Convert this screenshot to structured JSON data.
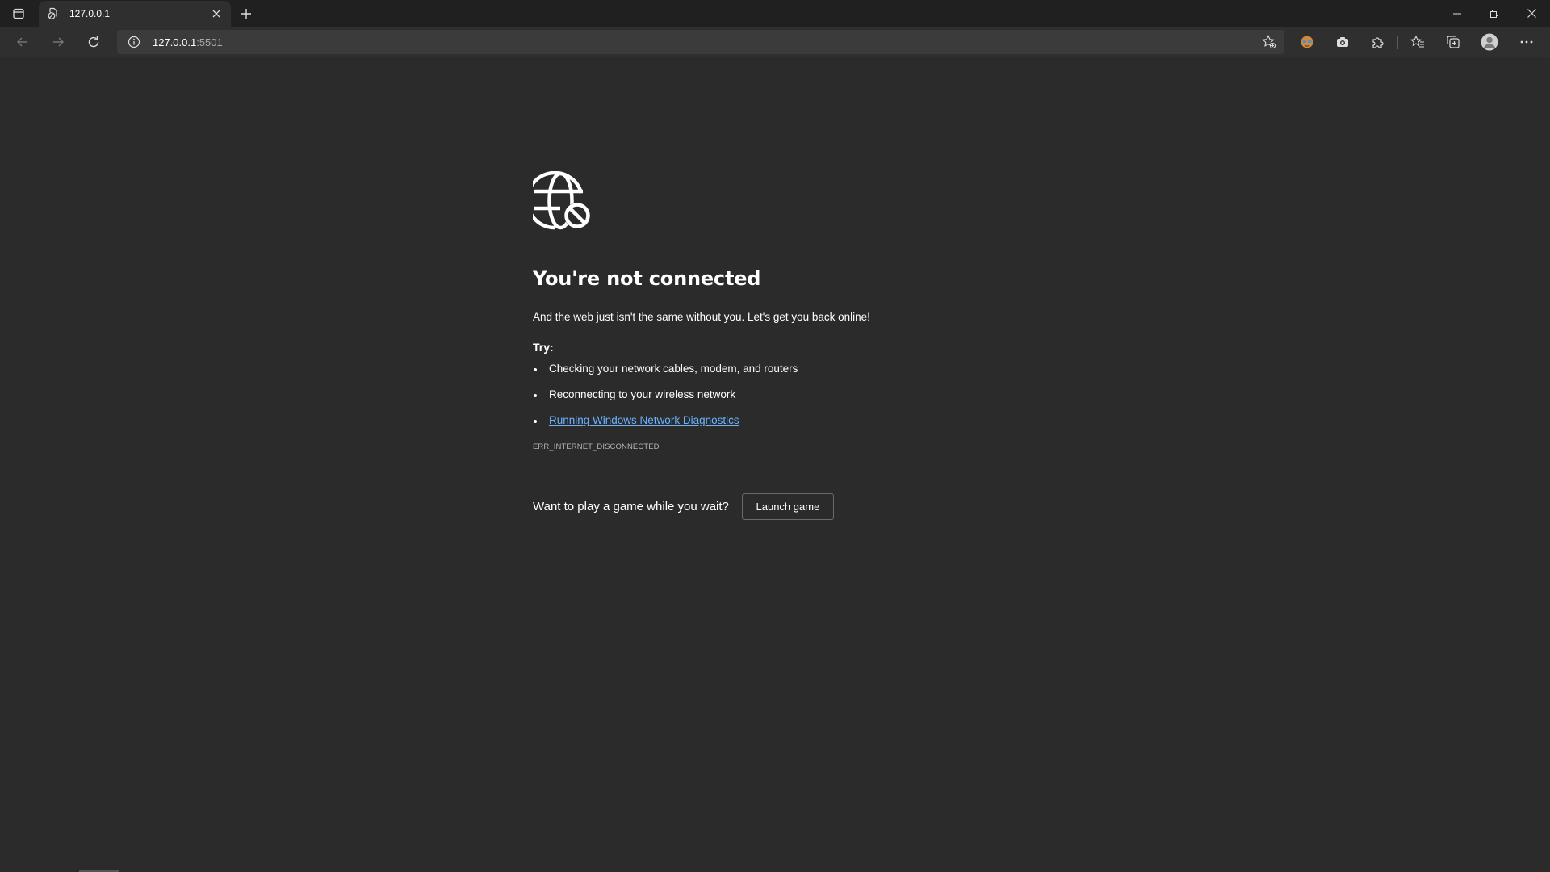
{
  "tab": {
    "title": "127.0.0.1"
  },
  "address": {
    "host": "127.0.0.1",
    "port": ":5501"
  },
  "page": {
    "heading": "You're not connected",
    "lead": "And the web just isn't the same without you. Let's get you back online!",
    "try_label": "Try:",
    "suggestions": [
      "Checking your network cables, modem, and routers",
      "Reconnecting to your wireless network"
    ],
    "diagnostics_link": "Running Windows Network Diagnostics",
    "error_code": "ERR_INTERNET_DISCONNECTED",
    "game_prompt": "Want to play a game while you wait?",
    "launch_button": "Launch game"
  },
  "icons": {
    "tab_actions": "tab-actions-icon",
    "favicon": "offline-page-icon",
    "tab_close": "close-icon",
    "new_tab": "plus-icon",
    "back": "back-arrow-icon",
    "forward": "forward-arrow-icon",
    "refresh": "refresh-icon",
    "site_info": "info-icon",
    "add_favorite": "add-favorite-icon",
    "extensions": [
      "extension-avatar-icon",
      "camera-icon",
      "puzzle-icon",
      "favorites-icon",
      "collections-icon",
      "profile-icon",
      "more-icon"
    ],
    "hero": "globe-blocked-icon"
  },
  "colors": {
    "background": "#2b2b2b",
    "link": "#6cb3ff",
    "tabstrip": "#202020",
    "toolbar": "#2f2f2f"
  }
}
